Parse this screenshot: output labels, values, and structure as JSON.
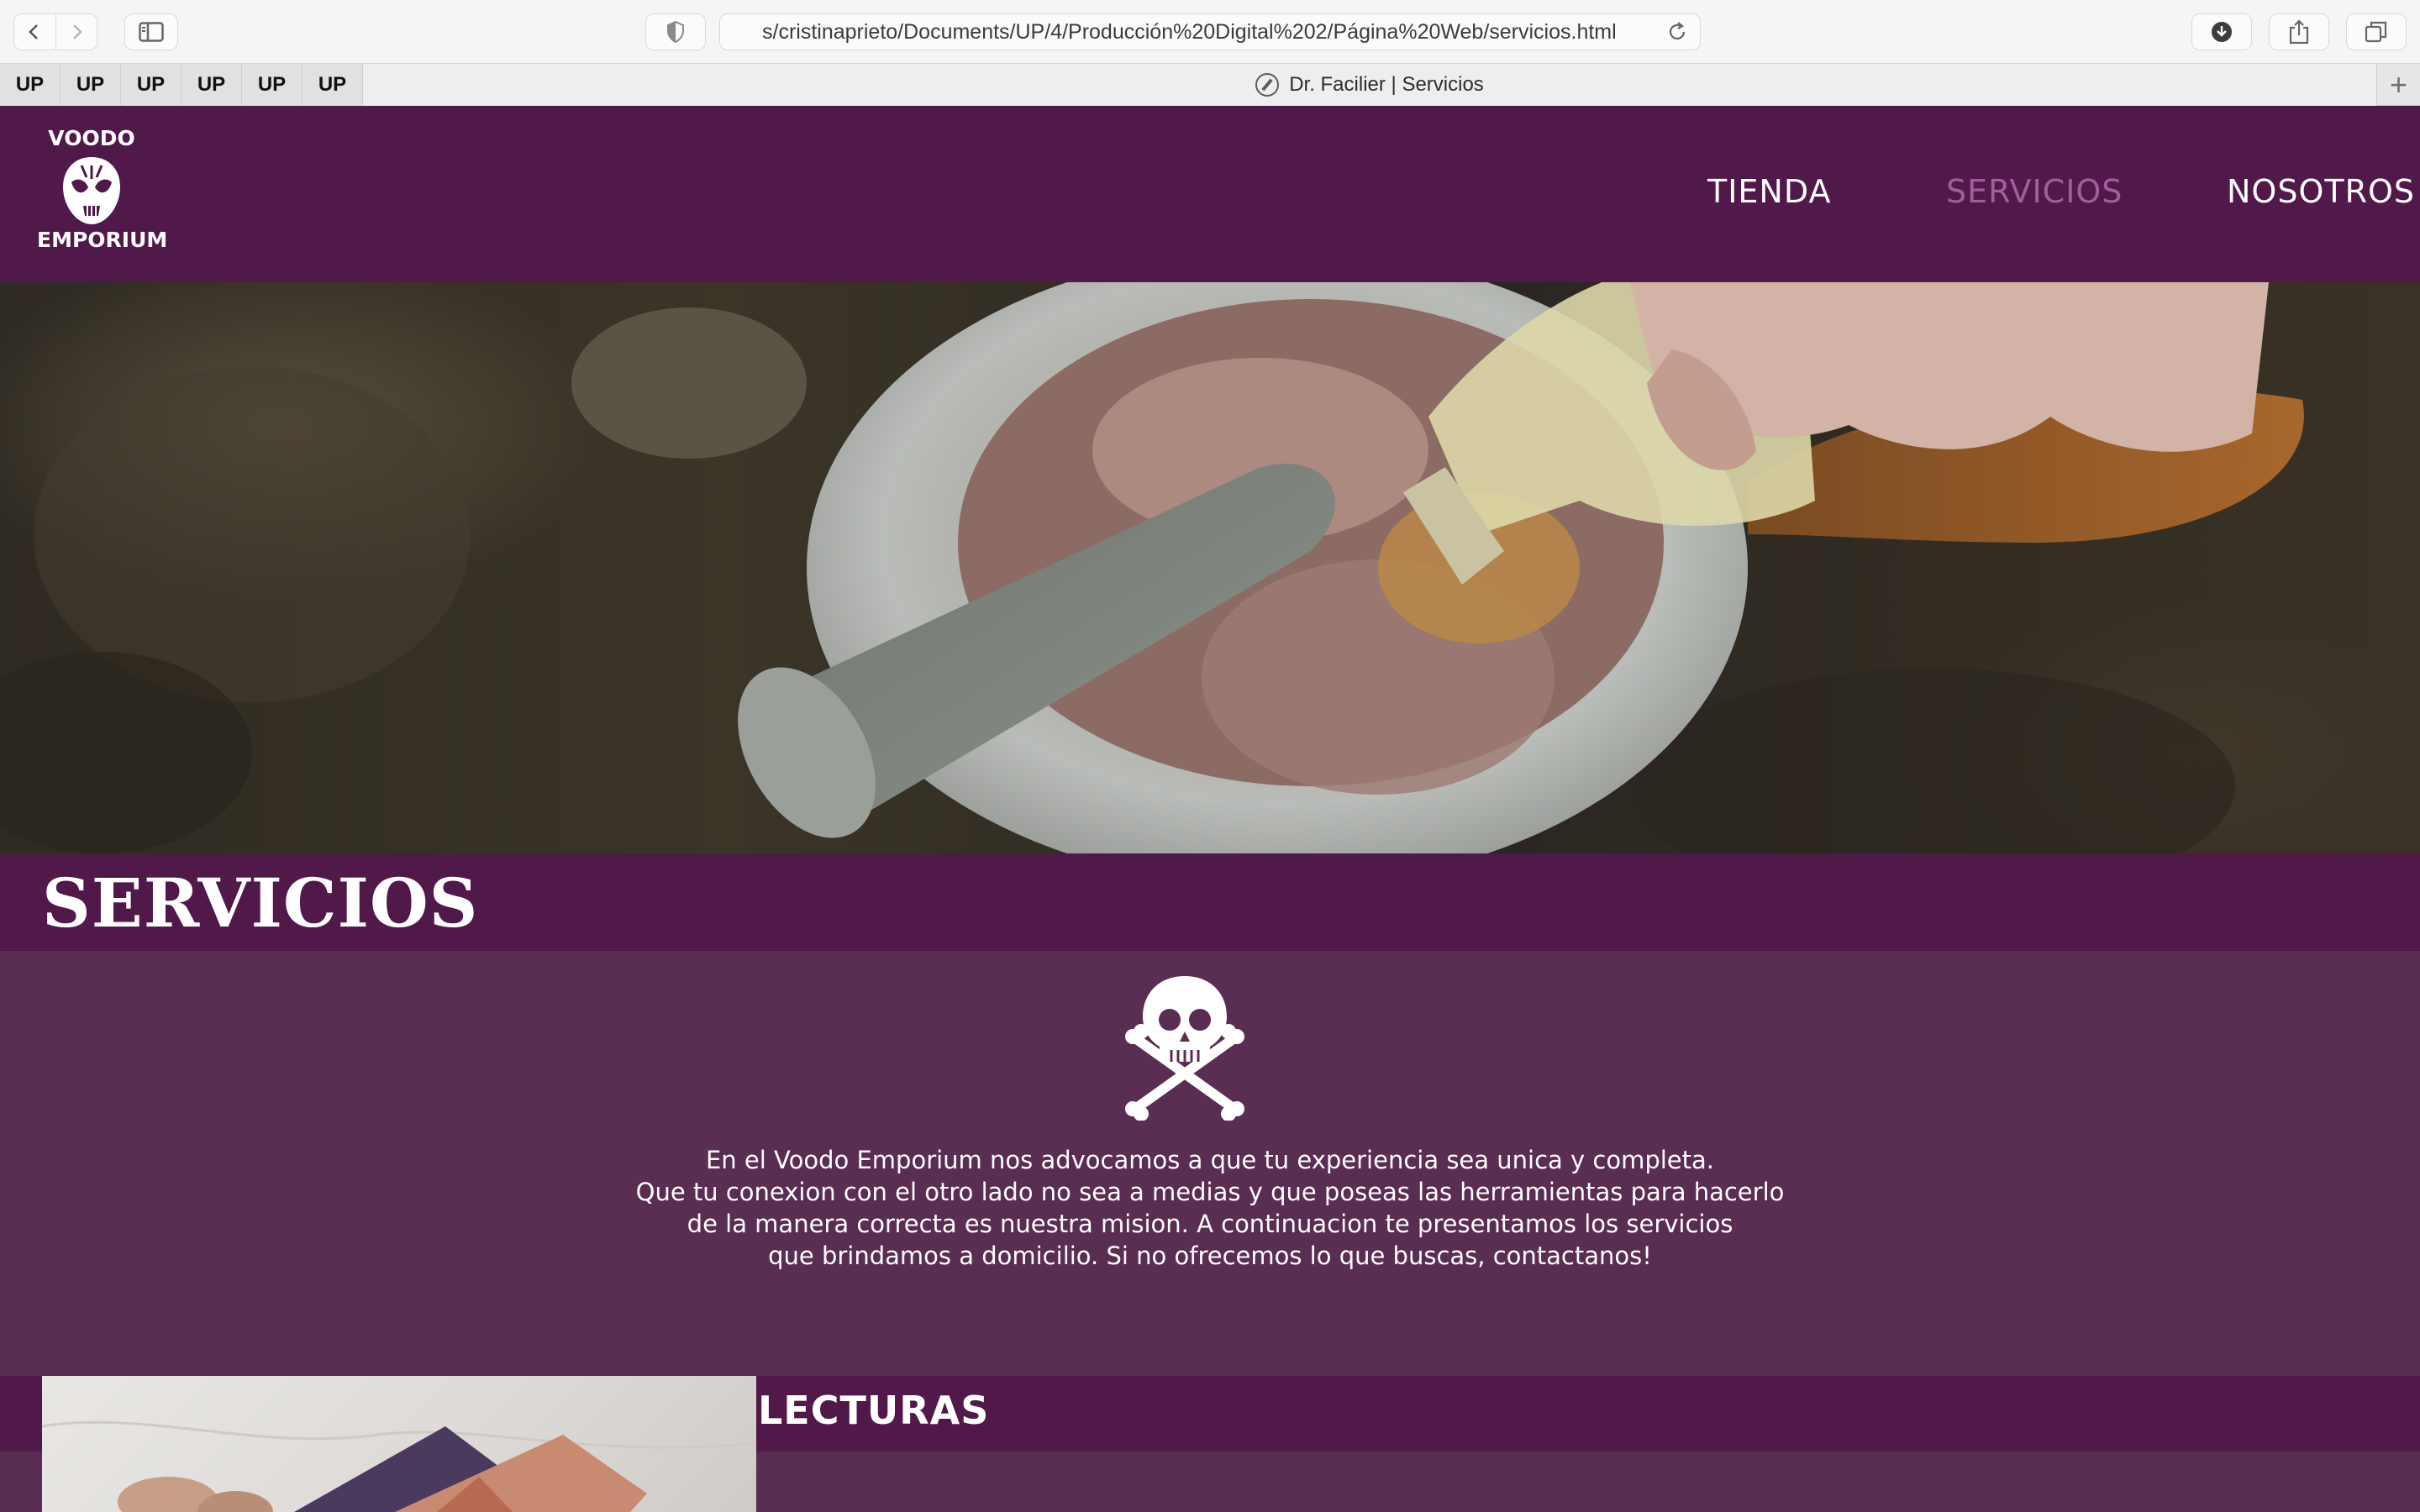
{
  "browser": {
    "url": "s/cristinaprieto/Documents/UP/4/Producción%20Digital%202/Página%20Web/servicios.html",
    "pinned_tabs": [
      "UP",
      "UP",
      "UP",
      "UP",
      "UP",
      "UP"
    ],
    "active_tab_title": "Dr. Facilier | Servicios",
    "new_tab_label": "+"
  },
  "site": {
    "logo": {
      "top_word": "VOODO",
      "bottom_word": "EMPORIUM"
    },
    "nav": {
      "tienda": "TIENDA",
      "servicios": "SERVICIOS",
      "nosotros": "NOSOTROS"
    },
    "page_title": "SERVICIOS",
    "intro_lines": [
      "En el Voodo Emporium nos advocamos a que tu experiencia sea unica y completa.",
      "Que tu conexion con el otro lado no sea a medias y que poseas las herramientas para hacerlo",
      "de la manera correcta es nuestra mision. A continuacion te presentamos los servicios",
      "que brindamos a domicilio. Si no ofrecemos lo que buscas, contactanos!"
    ],
    "section_title": "LECTURAS"
  },
  "colors": {
    "header_purple": "#51184a",
    "body_purple": "#5a2d52",
    "active_nav": "#a35c9d"
  }
}
